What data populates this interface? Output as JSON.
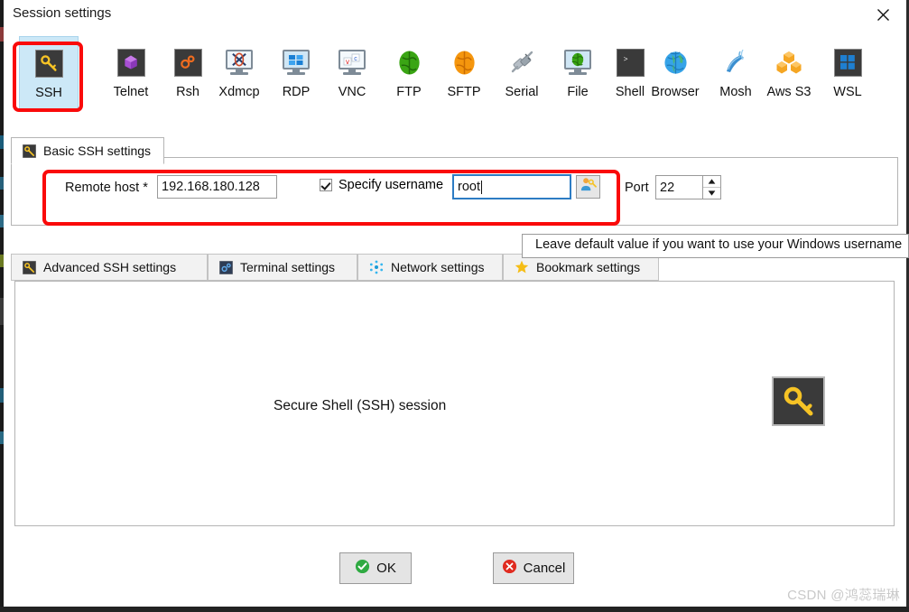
{
  "window": {
    "title": "Session settings",
    "close_label": "✕"
  },
  "protocols": [
    {
      "label": "SSH",
      "icon": "key-icon",
      "selected": true
    },
    {
      "label": "Telnet",
      "icon": "gem-icon",
      "selected": false
    },
    {
      "label": "Rsh",
      "icon": "gears-icon",
      "selected": false
    },
    {
      "label": "Xdmcp",
      "icon": "x-monitor-icon",
      "selected": false
    },
    {
      "label": "RDP",
      "icon": "windows-monitor-icon",
      "selected": false
    },
    {
      "label": "VNC",
      "icon": "vnc-monitor-icon",
      "selected": false
    },
    {
      "label": "FTP",
      "icon": "green-globe-icon",
      "selected": false
    },
    {
      "label": "SFTP",
      "icon": "orange-globe-icon",
      "selected": false
    },
    {
      "label": "Serial",
      "icon": "serial-plug-icon",
      "selected": false
    },
    {
      "label": "File",
      "icon": "file-monitor-icon",
      "selected": false
    },
    {
      "label": "Shell",
      "icon": "terminal-icon",
      "selected": false
    },
    {
      "label": "Browser",
      "icon": "blue-globe-icon",
      "selected": false
    },
    {
      "label": "Mosh",
      "icon": "satellite-icon",
      "selected": false
    },
    {
      "label": "Aws S3",
      "icon": "aws-s3-icon",
      "selected": false
    },
    {
      "label": "WSL",
      "icon": "windows-icon",
      "selected": false
    }
  ],
  "basic_group": {
    "tab_label": "Basic SSH settings",
    "tab_icon": "key-icon",
    "remote_host_label": "Remote host *",
    "remote_host_value": "192.168.180.128",
    "specify_username_label": "Specify username",
    "specify_username_checked": true,
    "username_value": "root",
    "username_focused": true,
    "user_key_button_icon": "user-key-icon",
    "port_label": "Port",
    "port_value": "22",
    "spin_up_icon": "caret-up-icon",
    "spin_down_icon": "caret-down-icon"
  },
  "tooltip": {
    "text": "Leave default value if you want to use your Windows username"
  },
  "lower_tabs": [
    {
      "label": "Advanced SSH settings",
      "icon": "key-icon"
    },
    {
      "label": "Terminal settings",
      "icon": "terminal-settings-icon"
    },
    {
      "label": "Network settings",
      "icon": "network-nodes-icon"
    },
    {
      "label": "Bookmark settings",
      "icon": "star-icon"
    }
  ],
  "main_panel": {
    "caption": "Secure Shell (SSH) session",
    "big_icon": "key-icon"
  },
  "footer": {
    "ok_label": "OK",
    "ok_icon": "check-circle-icon",
    "cancel_label": "Cancel",
    "cancel_icon": "x-circle-icon"
  },
  "watermark": {
    "text": "CSDN @鸿蕊瑞琳"
  },
  "colors": {
    "annotation": "#fa0a0a",
    "selected_tab": "#cce8f7",
    "ok_green": "#2faa42",
    "cancel_red": "#e02b20",
    "key_yellow": "#f6c325"
  }
}
